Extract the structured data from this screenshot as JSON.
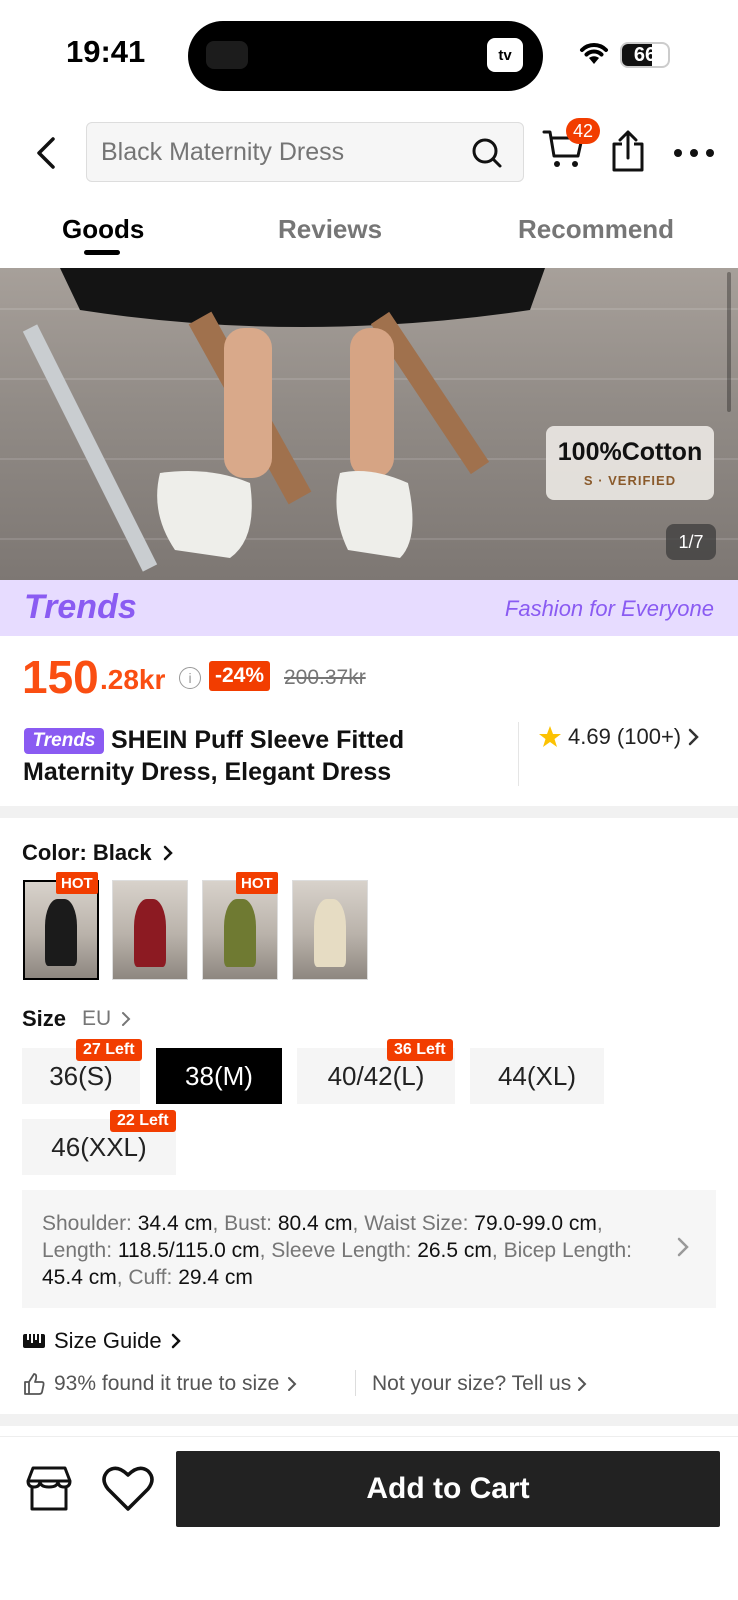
{
  "status": {
    "time": "19:41",
    "battery": "66",
    "battery_level": 0.66,
    "island_app": "tv"
  },
  "header": {
    "search_placeholder": "Black Maternity Dress",
    "cart_count": "42",
    "icons": [
      "back-arrow-icon",
      "search-icon",
      "cart-icon",
      "share-icon",
      "more-icon"
    ]
  },
  "tabs": [
    {
      "label": "Goods",
      "active": true
    },
    {
      "label": "Reviews",
      "active": false
    },
    {
      "label": "Recommend",
      "active": false
    }
  ],
  "gallery": {
    "badge_title": "100%Cotton",
    "badge_sub": "S · VERIFIED",
    "counter": "1/7"
  },
  "trends_banner": {
    "logo": "Trends",
    "slogan": "Fashion for Everyone"
  },
  "price": {
    "main": "150",
    "decimal": ".28kr",
    "discount": "-24%",
    "original": "200.37kr",
    "color": "#fa4e12"
  },
  "product": {
    "tag": "Trends",
    "title": "SHEIN Puff Sleeve Fitted Maternity Dress, Elegant Dress",
    "rating": "4.69 (100+)"
  },
  "color": {
    "label": "Color: Black",
    "options": [
      {
        "name": "Black",
        "swatch": "#1b1b1b",
        "hot": "HOT",
        "selected": true
      },
      {
        "name": "Burgundy",
        "swatch": "#8c1a22",
        "hot": "",
        "selected": false
      },
      {
        "name": "Olive",
        "swatch": "#6f7a32",
        "hot": "HOT",
        "selected": false
      },
      {
        "name": "Beige",
        "swatch": "#e6dcc3",
        "hot": "",
        "selected": false
      }
    ]
  },
  "size": {
    "label": "Size",
    "unit": "EU",
    "options": [
      {
        "label": "36(S)",
        "stock": "27 Left",
        "selected": false
      },
      {
        "label": "38(M)",
        "stock": "",
        "selected": true
      },
      {
        "label": "40/42(L)",
        "stock": "36 Left",
        "selected": false
      },
      {
        "label": "44(XL)",
        "stock": "",
        "selected": false
      },
      {
        "label": "46(XXL)",
        "stock": "22 Left",
        "selected": false
      }
    ]
  },
  "measurements": {
    "shoulder_label": "Shoulder:",
    "shoulder": "34.4 cm",
    "bust_label": "Bust:",
    "bust": "80.4 cm",
    "waist_label": "Waist Size:",
    "waist": "79.0-99.0 cm",
    "length_label": "Length:",
    "length": "118.5/115.0 cm",
    "sleeve_label": "Sleeve Length:",
    "sleeve": "26.5 cm",
    "bicep_label": "Bicep Length:",
    "bicep": "45.4 cm",
    "cuff_label": "Cuff:",
    "cuff": "29.4 cm"
  },
  "size_guide": {
    "label": "Size Guide",
    "fit": "93% found it true to size",
    "tell_us": "Not your size? Tell us"
  },
  "bottom": {
    "add_to_cart": "Add to Cart"
  }
}
